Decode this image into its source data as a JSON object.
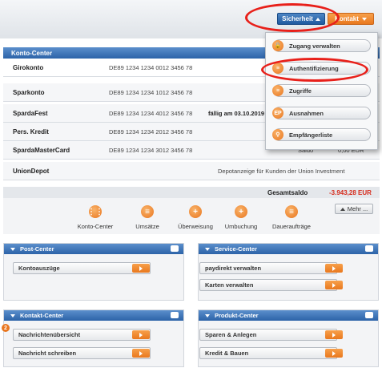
{
  "header": {
    "security_button": "Sicherheit",
    "contact_button": "Kontakt"
  },
  "konto_center": {
    "title": "Konto-Center",
    "accounts": [
      {
        "name": "Girokonto",
        "iban": "DE89 1234 1234 0012 3456 78",
        "note": ""
      },
      {
        "name": "Sparkonto",
        "iban": "DE89 1234 1234 1012 3456 78",
        "note": ""
      },
      {
        "name": "SpardaFest",
        "iban": "DE89 1234 1234 4012 3456 78",
        "note": "fällig am 03.10.2019"
      },
      {
        "name": "Pers. Kredit",
        "iban": "DE89 1234 1234 2012 3456 78",
        "note": ""
      },
      {
        "name": "SpardaMasterCard",
        "iban": "DE89 1234 1234 3012 3456 78",
        "note": "Saldo"
      },
      {
        "name": "UnionDepot",
        "iban": "",
        "note": "Depotanzeige für Kunden der Union Investment"
      }
    ],
    "balance_value_partial": "0,00 EUR",
    "total_label": "Gesamtsaldo",
    "total_value": "-3.943,28 EUR",
    "more_button": "Mehr ..."
  },
  "quicklinks": [
    {
      "label": "Konto-Center",
      "icon": "grid-icon",
      "glyph": "⋮⋮"
    },
    {
      "label": "Umsätze",
      "icon": "list-icon",
      "glyph": "≡"
    },
    {
      "label": "Überweisung",
      "icon": "plus-icon",
      "glyph": "+"
    },
    {
      "label": "Umbuchung",
      "icon": "plus-icon",
      "glyph": "+"
    },
    {
      "label": "Daueraufträge",
      "icon": "list-icon",
      "glyph": "≡"
    }
  ],
  "security_menu": [
    {
      "label": "Zugang verwalten",
      "icon": "lock-icon",
      "glyph": "🔒"
    },
    {
      "label": "Authentifizierung",
      "icon": "list-icon",
      "glyph": "≡"
    },
    {
      "label": "Zugriffe",
      "icon": "list-icon",
      "glyph": "≡"
    },
    {
      "label": "Ausnahmen",
      "icon": "exceptions-icon",
      "glyph": "EP"
    },
    {
      "label": "Empfängerliste",
      "icon": "search-icon",
      "glyph": "⚲"
    }
  ],
  "post_center": {
    "title": "Post-Center",
    "items": [
      "Kontoauszüge"
    ]
  },
  "service_center": {
    "title": "Service-Center",
    "items": [
      "paydirekt verwalten",
      "Karten verwalten"
    ]
  },
  "kontakt_center": {
    "title": "Kontakt-Center",
    "items": [
      "Nachrichtenübersicht",
      "Nachricht schreiben"
    ],
    "badge": "2"
  },
  "produkt_center": {
    "title": "Produkt-Center",
    "items": [
      "Sparen & Anlegen",
      "Kredit & Bauen"
    ]
  },
  "colors": {
    "primary_blue": "#2c63a8",
    "accent_orange": "#e9781e",
    "highlight_red": "#e8201a",
    "negative_red": "#d62b1c"
  }
}
